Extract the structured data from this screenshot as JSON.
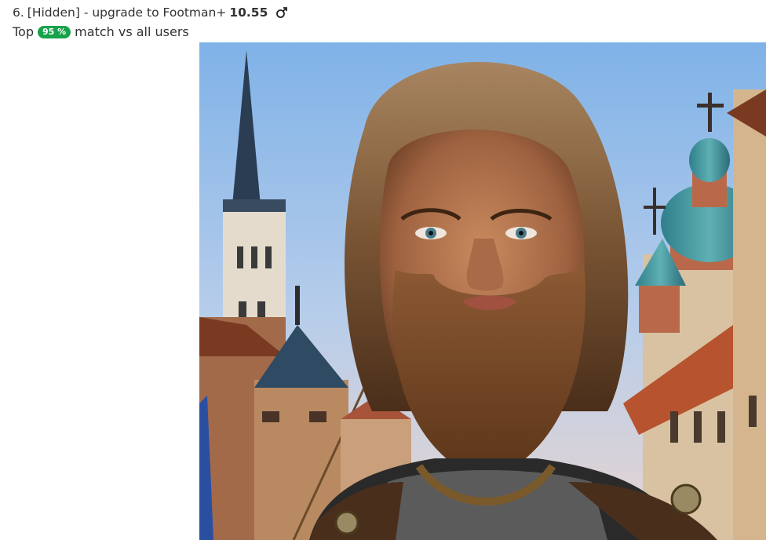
{
  "profile": {
    "rank_label": "6.",
    "name_text": "[Hidden] - upgrade to Footman+",
    "score": "10.55",
    "gender_icon": "male-symbol-icon",
    "match_prefix": "Top",
    "match_percent": "95 %",
    "match_suffix": "match vs all users",
    "badge_color": "#16a34a"
  },
  "photo": {
    "icon": "portrait-image"
  }
}
